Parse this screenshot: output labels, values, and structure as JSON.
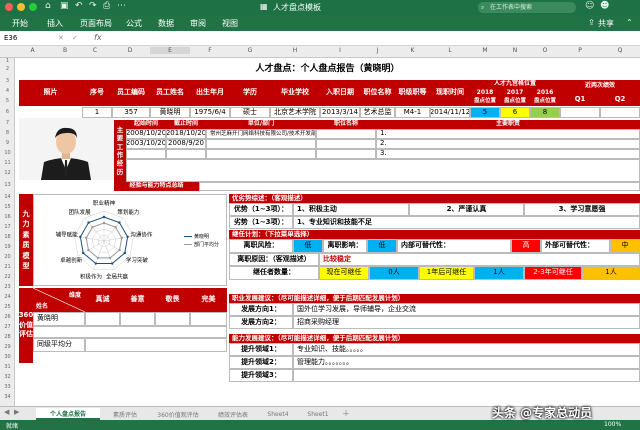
{
  "window": {
    "title": "人才盘点模板",
    "search_placeholder": "在工作表中搜索"
  },
  "ribbon": {
    "tabs": [
      "开始",
      "插入",
      "页面布局",
      "公式",
      "数据",
      "审阅",
      "视图"
    ],
    "share": "共享"
  },
  "formula_bar": {
    "cell_ref": "E36",
    "fx": "fx",
    "value": ""
  },
  "columns": [
    "A",
    "B",
    "C",
    "D",
    "E",
    "F",
    "G",
    "H",
    "I",
    "J",
    "K",
    "L",
    "M",
    "N",
    "O",
    "P",
    "Q"
  ],
  "rows": [
    "1",
    "2",
    "3",
    "4",
    "5",
    "6",
    "7",
    "8",
    "9",
    "10",
    "11",
    "12",
    "13",
    "14",
    "15",
    "16",
    "17",
    "18",
    "19",
    "20",
    "21",
    "22",
    "23",
    "24",
    "25",
    "26",
    "27",
    "28",
    "29",
    "30",
    "31",
    "32",
    "33",
    "34",
    "35",
    "36"
  ],
  "sheet": {
    "title": "人才盘点：个人盘点报告（黄晓明）",
    "headers": {
      "photo": "照片",
      "seq": "序号",
      "emp_id": "员工编码",
      "name": "员工姓名",
      "birth": "出生年月",
      "edu": "学历",
      "school": "毕业学校",
      "join": "入职日期",
      "title": "职位名称",
      "level": "职级职等",
      "current": "现职时间",
      "nine_box": "人才九宫格位置",
      "year2018": "2018",
      "year2017": "2017",
      "year2016": "2016",
      "pos_label": "盘点位置",
      "recent": "近两次绩效",
      "q1": "Q1",
      "q2": "Q2"
    },
    "record": {
      "seq": "1",
      "emp_id": "357",
      "name": "黄晓明",
      "birth": "1975/6/4",
      "edu": "硕士",
      "school": "北京艺术学院",
      "join": "2013/3/14",
      "title": "艺术总监",
      "level": "M4-1",
      "current": "2014/11/12",
      "p2018": "5",
      "p2017": "6",
      "p2016": "8"
    },
    "work": {
      "side": "主要工作经历",
      "start": "起始时间",
      "end": "截止时间",
      "company": "单位/部门",
      "position": "职位名称",
      "duty": "主要职责",
      "rows": [
        {
          "start": "2008/10/20",
          "end": "2018/10/20",
          "company": "常州芝麻开门网络科技有限公司/技术开发部",
          "position": "",
          "duty": "1."
        },
        {
          "start": "2003/10/20",
          "end": "2008/9/20",
          "company": "",
          "position": "",
          "duty": "2."
        },
        {
          "start": "",
          "end": "",
          "company": "",
          "position": "",
          "duty": "3."
        }
      ]
    },
    "summary": "经验与能力特点总结",
    "nine": {
      "side": "九力素质模型",
      "labels": [
        "职业精神",
        "策划能力",
        "沟通协作",
        "学习突破",
        "全局共赢",
        "积极作为",
        "卓越创新",
        "辅导赋能",
        "团队发展"
      ],
      "legend": [
        "黄晓明",
        "部门平均分"
      ],
      "series": [
        {
          "name": "黄晓明",
          "values": [
            4,
            4,
            4,
            4,
            4,
            4,
            4,
            4,
            4
          ]
        },
        {
          "name": "部门平均分",
          "values": [
            3,
            3,
            3,
            3,
            3,
            3,
            3,
            3,
            3
          ]
        }
      ]
    },
    "advantage": {
      "header": "优劣势综述：（客观描述）",
      "strength_label": "优势（1~3项）：",
      "strengths": [
        "1、积极主动",
        "2、严谨认真",
        "3、学习意愿强"
      ],
      "weak_label": "劣势（1~3项）：",
      "weak": "1、专业知识和技能不足"
    },
    "succession": {
      "header": "继任计划：（下拉菜单选择）",
      "risk_label": "离职风险：",
      "risk": "低",
      "impact_label": "离职影响：",
      "impact": "低",
      "inner_label": "内部可替代性：",
      "inner": "高",
      "outer_label": "外部可替代性：",
      "outer": "中",
      "reason_label": "离职原因：（客观描述）",
      "reason": "比较稳定",
      "count_label": "继任者数量：",
      "now_label": "现在可继任",
      "now": "0人",
      "one_label": "1年后可继任",
      "one": "1人",
      "two_label": "2-3年可继任",
      "two": "1人"
    },
    "eval360": {
      "side": "360价值评估",
      "dim": "维度",
      "name_label": "姓名",
      "cols": [
        "真诚",
        "善意",
        "敬畏",
        "完美"
      ],
      "person": "黄晓明",
      "avg": "同级平均分"
    },
    "career": {
      "header": "职业发展建议：（尽可能描述详细，便于后期匹配发展计划）",
      "d1_label": "发展方向1：",
      "d1": "国外位学习发展，导师辅导，企业交流",
      "d2_label": "发展方向2：",
      "d2": "招商采购经理"
    },
    "ability": {
      "header": "能力发展建议：（尽可能描述详细，便于后期匹配发展计划）",
      "a1_label": "提升领域1：",
      "a1": "专业知识、技能。。。。。",
      "a2_label": "提升领域2：",
      "a2": "管理能力。。。。。。。",
      "a3_label": "提升领域3：",
      "a3": ""
    }
  },
  "tabs": [
    "个人盘点报告",
    "素质评估",
    "360价值观评估",
    "绩效评估表",
    "Sheet4",
    "Sheet1"
  ],
  "status": {
    "text": "就绪",
    "zoom": "100%"
  },
  "watermark": "头条 @专家总动员",
  "colors": {
    "excel_green": "#217346",
    "header_red": "#c00000"
  }
}
